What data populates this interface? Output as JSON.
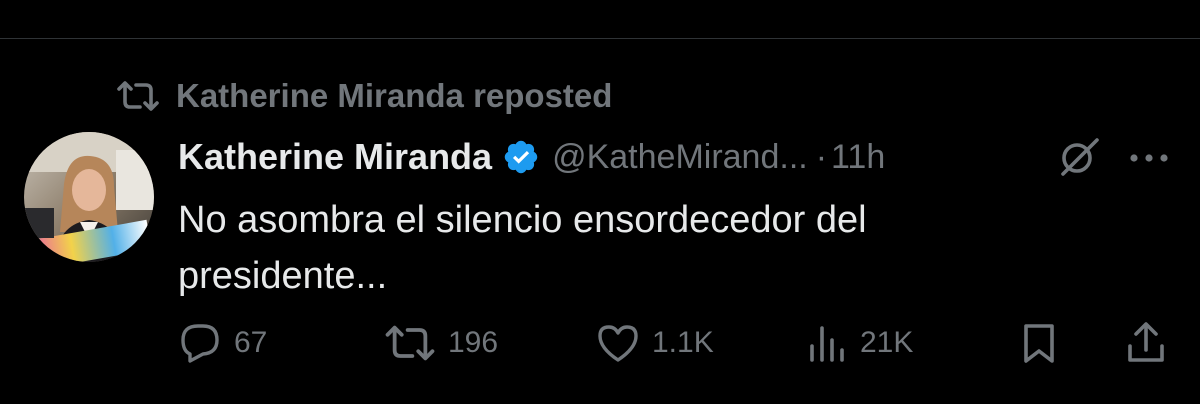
{
  "repost": {
    "text": "Katherine Miranda reposted",
    "icon": "repost-icon"
  },
  "tweet": {
    "author": {
      "name": "Katherine Miranda",
      "handle": "@KatheMirand...",
      "verified": true,
      "avatar": "avatar-photo"
    },
    "separator": "·",
    "time": "11h",
    "text": "No asombra el silencio ensordecedor del presidente..."
  },
  "actions": {
    "reply": {
      "icon": "reply-icon",
      "count": "67"
    },
    "repost": {
      "icon": "repost-icon",
      "count": "196"
    },
    "like": {
      "icon": "heart-icon",
      "count": "1.1K"
    },
    "views": {
      "icon": "views-icon",
      "count": "21K"
    },
    "bookmark": {
      "icon": "bookmark-icon"
    },
    "share": {
      "icon": "share-icon"
    }
  },
  "colors": {
    "background": "#000000",
    "primary_text": "#e7e9ea",
    "secondary_text": "#71767b",
    "verified_blue": "#1d9bf0",
    "divider": "#2f3336"
  }
}
